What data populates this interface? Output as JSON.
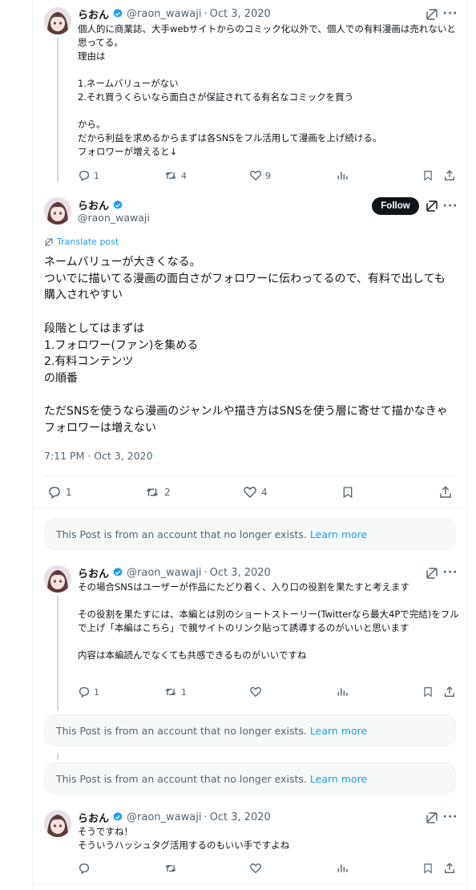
{
  "colors": {
    "text": "#0f1419",
    "muted": "#536471",
    "accent": "#1d9bf0",
    "border": "#eff3f4",
    "notice_bg": "#f7f9f9",
    "follow_bg": "#0f1419"
  },
  "icons": {
    "verified": "verified-badge-icon",
    "grok": "grok-icon",
    "more": "more-icon",
    "reply": "reply-icon",
    "repost": "repost-icon",
    "like": "like-icon",
    "views": "views-icon",
    "bookmark": "bookmark-icon",
    "share": "share-icon",
    "translate": "translate-icon"
  },
  "more_label": "···",
  "posts": {
    "p1": {
      "name": "らおん",
      "handle": "@raon_wawaji",
      "sep": "·",
      "date": "Oct 3, 2020",
      "text": "個人的に商業誌、大手webサイトからのコミック化以外で、個人での有料漫画は売れないと思ってる。\n理由は\n\n1.ネームバリューがない\n2.それ買うくらいなら面白さが保証されてる有名なコミックを買う\n\nから。\nだから利益を求めるからまずは各SNSをフル活用して漫画を上げ続ける。\nフォロワーが増えると↓",
      "replies": "1",
      "reposts": "4",
      "likes": "9"
    },
    "main": {
      "name": "らおん",
      "handle": "@raon_wawaji",
      "follow_label": "Follow",
      "translate_label": "Translate post",
      "text": "ネームバリューが大きくなる。\nついでに描いてる漫画の面白さがフォロワーに伝わってるので、有料で出しても購入されやすい\n\n段階としてはまずは\n1.フォロワー(ファン)を集める\n2.有料コンテンツ\nの順番\n\nただSNSを使うなら漫画のジャンルや描き方はSNSを使う層に寄せて描かなきゃフォロワーは増えない",
      "timestamp": "7:11 PM · Oct 3, 2020",
      "replies": "1",
      "reposts": "2",
      "likes": "4"
    },
    "p3": {
      "name": "らおん",
      "handle": "@raon_wawaji",
      "sep": "·",
      "date": "Oct 3, 2020",
      "text": "その場合SNSはユーザーが作品にたどり着く、入り口の役割を果たすと考えます\n\nその役割を果たすには、本編とは別のショートストーリー(Twitterなら最大4Pで完結)をフルで上げ「本編はこちら」で親サイトのリンク貼って誘導するのがいいと思います\n\n内容は本編読んでなくても共感できるものがいいですね",
      "replies": "1",
      "reposts": "1"
    },
    "p4": {
      "name": "らおん",
      "handle": "@raon_wawaji",
      "sep": "·",
      "date": "Oct 3, 2020",
      "text": "そうですね！\nそういうハッシュタグ活用するのもいい手ですよね"
    }
  },
  "notices": {
    "text": "This Post is from an account that no longer exists.",
    "learn_more": "Learn more"
  }
}
